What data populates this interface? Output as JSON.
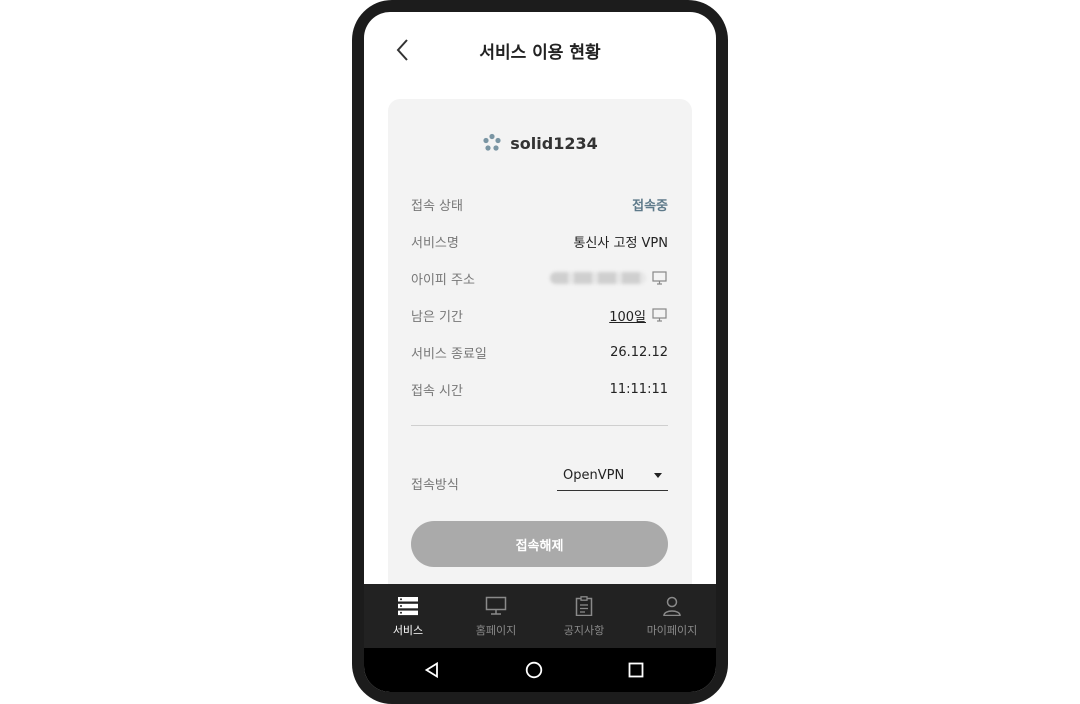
{
  "header": {
    "title": "서비스 이용 현황"
  },
  "user": {
    "id": "solid1234"
  },
  "info": {
    "status_label": "접속 상태",
    "status_value": "접속중",
    "service_label": "서비스명",
    "service_value": "통신사 고정 VPN",
    "ip_label": "아이피 주소",
    "remaining_label": "남은 기간",
    "remaining_value": "100일",
    "end_label": "서비스 종료일",
    "end_value": "26.12.12",
    "time_label": "접속 시간",
    "time_value": "11:11:11"
  },
  "connection": {
    "method_label": "접속방식",
    "method_value": "OpenVPN",
    "disconnect_label": "접속해제"
  },
  "tabs": [
    {
      "label": "서비스",
      "icon": "server-icon",
      "active": true
    },
    {
      "label": "홈페이지",
      "icon": "monitor-icon",
      "active": false
    },
    {
      "label": "공지사항",
      "icon": "clipboard-icon",
      "active": false
    },
    {
      "label": "마이페이지",
      "icon": "user-icon",
      "active": false
    }
  ],
  "colors": {
    "status": "#5e7a8a",
    "card_bg": "#f3f3f3",
    "button_bg": "#aaaaaa",
    "tabbar_bg": "#222222"
  }
}
